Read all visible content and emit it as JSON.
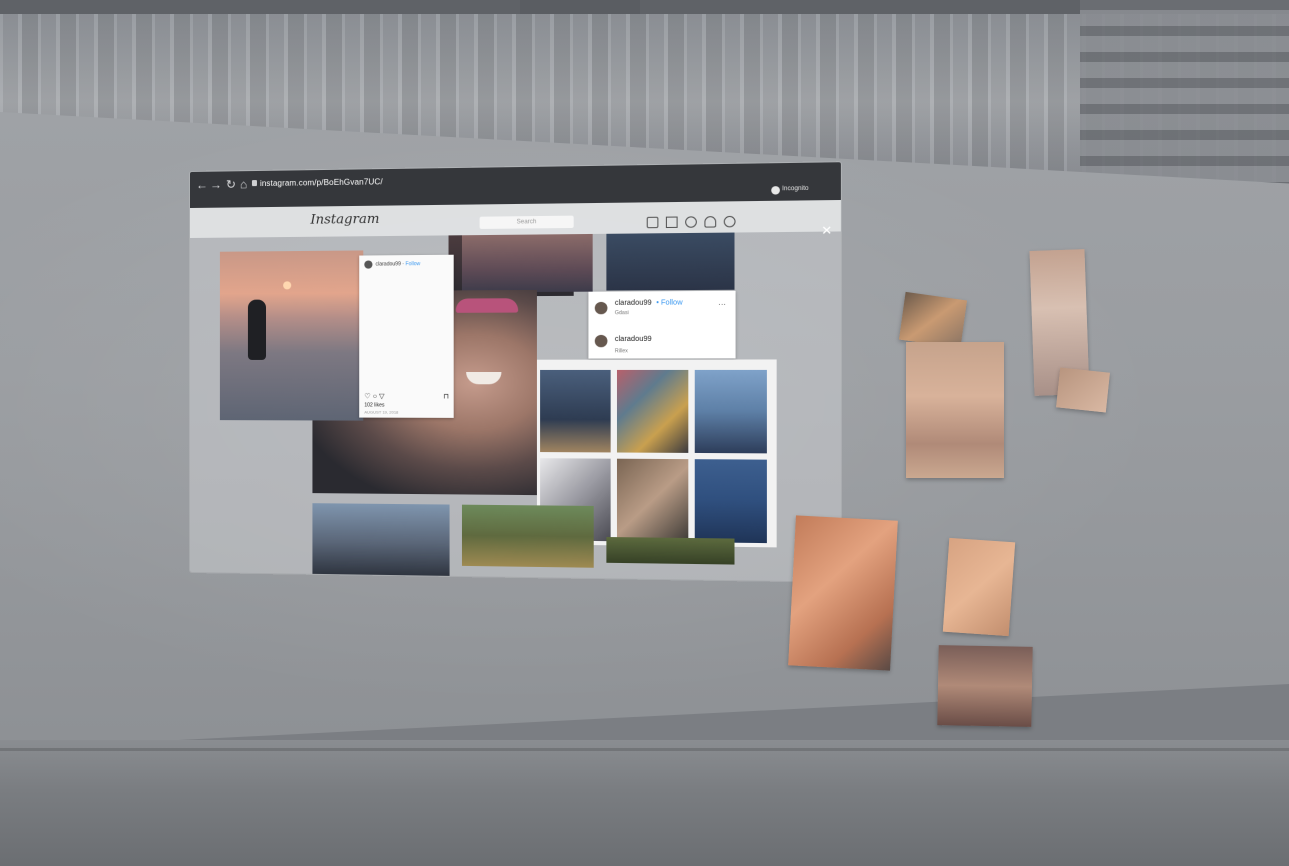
{
  "browser": {
    "url": "instagram.com/p/BoEhGvan7UC/",
    "incognito_label": "Incognito",
    "close_icon": "close-icon"
  },
  "instagram": {
    "logo": "Instagram",
    "search_placeholder": "Search",
    "nav_icons": [
      "home-icon",
      "filter-icon",
      "compass-icon",
      "heart-icon",
      "profile-icon"
    ]
  },
  "card": {
    "username": "claradou99",
    "follow": "Follow",
    "likes": "102 likes",
    "date": "AUGUST 19, 2018"
  },
  "comment": {
    "username": "claradou99",
    "follow": "• Follow",
    "location": "Gdasi",
    "more": "···",
    "caption_user": "claradou99",
    "caption": "Rillex"
  },
  "grid_colors": [
    [
      "#3f5573",
      "#7a5a5a",
      "#5b84b6"
    ],
    [
      "#9a9aa2",
      "#7a6553",
      "#2f5a91"
    ]
  ]
}
